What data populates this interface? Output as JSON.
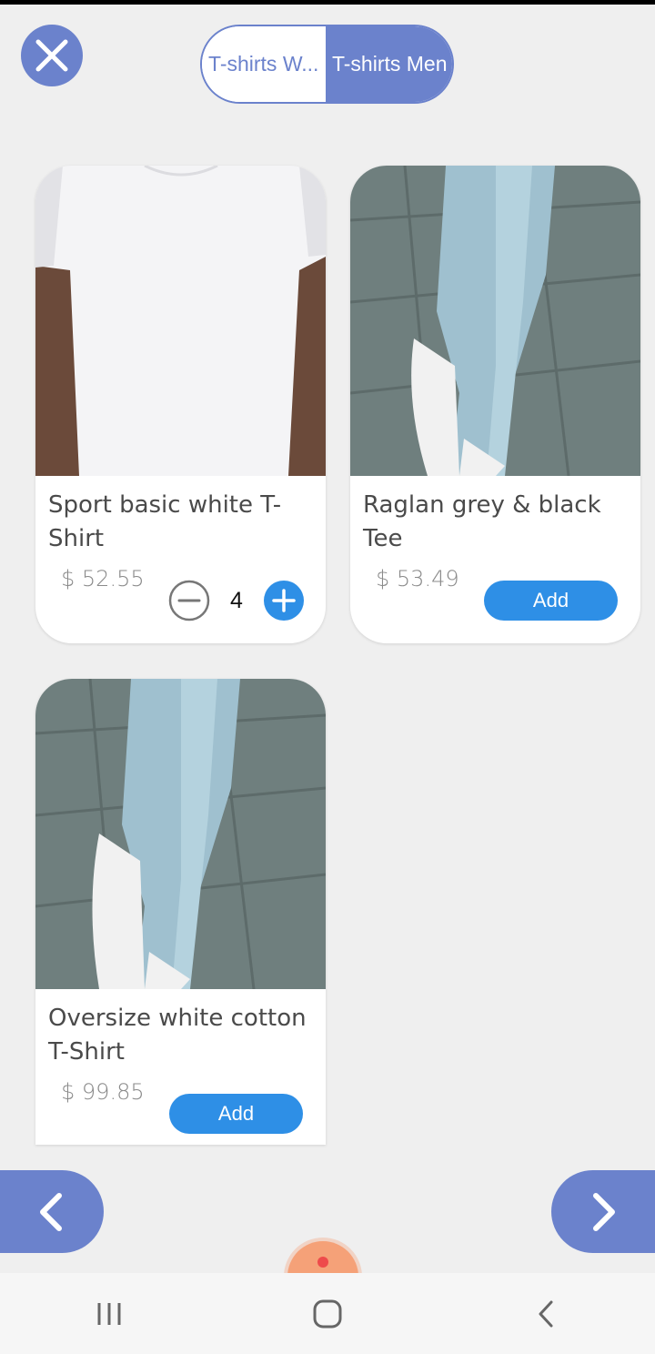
{
  "header": {
    "tabs": [
      {
        "label": "T-shirts W...",
        "selected": false
      },
      {
        "label": "T-shirts Men",
        "selected": true
      }
    ]
  },
  "products": [
    {
      "title": "Sport basic white T-Shirt",
      "price": "$ 52.55",
      "quantity": "4"
    },
    {
      "title": "Raglan grey & black Tee",
      "price": "$ 53.49",
      "action": "Add"
    },
    {
      "title": "Oversize white cotton T-Shirt",
      "price": "$ 99.85",
      "action": "Add"
    }
  ],
  "colors": {
    "accent": "#6b82cc",
    "button_blue": "#2e8fe6",
    "fab": "#f5a178",
    "background": "#efefef"
  },
  "icons": {
    "close": "close-icon",
    "prev": "chevron-left-icon",
    "next": "chevron-right-icon",
    "minus": "minus-circle-icon",
    "plus": "plus-circle-icon",
    "recents": "recents-icon",
    "home": "home-icon",
    "back": "back-icon"
  }
}
